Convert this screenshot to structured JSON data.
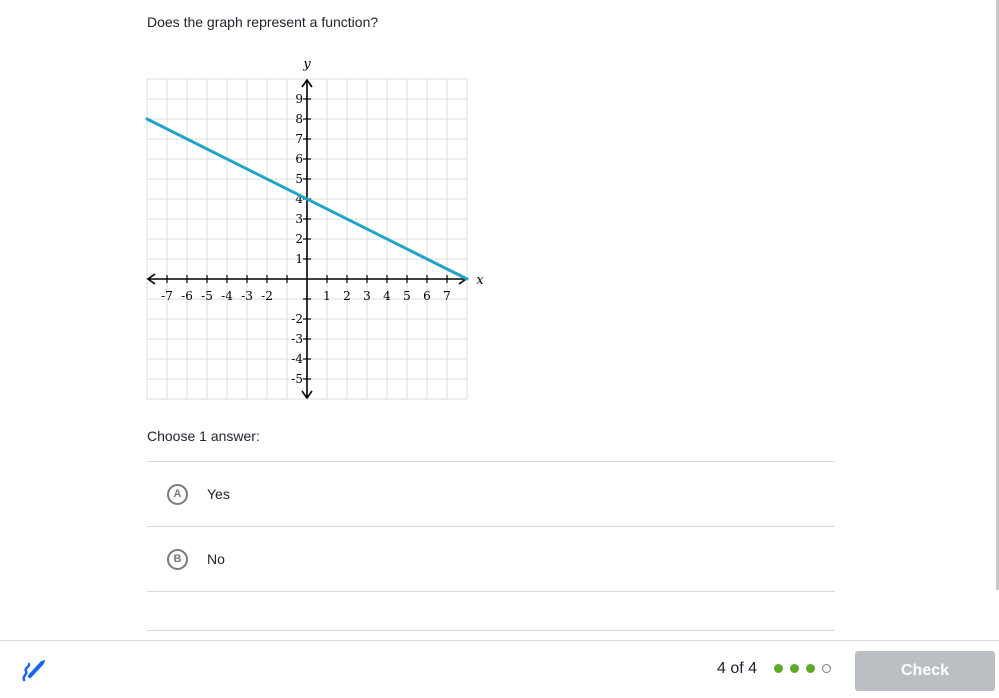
{
  "question": "Does the graph represent a function?",
  "graph": {
    "x_axis_label": "x",
    "y_axis_label": "y",
    "x_ticks": [
      "-7",
      "-6",
      "-5",
      "-4",
      "-3",
      "-2",
      "1",
      "2",
      "3",
      "4",
      "5",
      "6",
      "7"
    ],
    "y_ticks": [
      "9",
      "8",
      "7",
      "6",
      "5",
      "4",
      "3",
      "2",
      "1",
      "-2",
      "-3",
      "-4",
      "-5"
    ],
    "x_range": [
      -8,
      8
    ],
    "y_range": [
      -6,
      10
    ],
    "line_color": "#1fa3c8",
    "line_points": [
      [
        -8,
        8
      ],
      [
        8,
        0
      ]
    ]
  },
  "chooser_label": "Choose 1 answer:",
  "choices": [
    {
      "letter": "A",
      "label": "Yes"
    },
    {
      "letter": "B",
      "label": "No"
    }
  ],
  "footer": {
    "progress": "4 of 4",
    "dots": [
      "filled",
      "filled",
      "filled",
      "empty"
    ],
    "check_label": "Check"
  },
  "colors": {
    "accent_green": "#5fa629",
    "button_disabled": "#bbbec2",
    "pencil_blue": "#1865f2"
  },
  "icons": [
    "pencil-icon"
  ]
}
